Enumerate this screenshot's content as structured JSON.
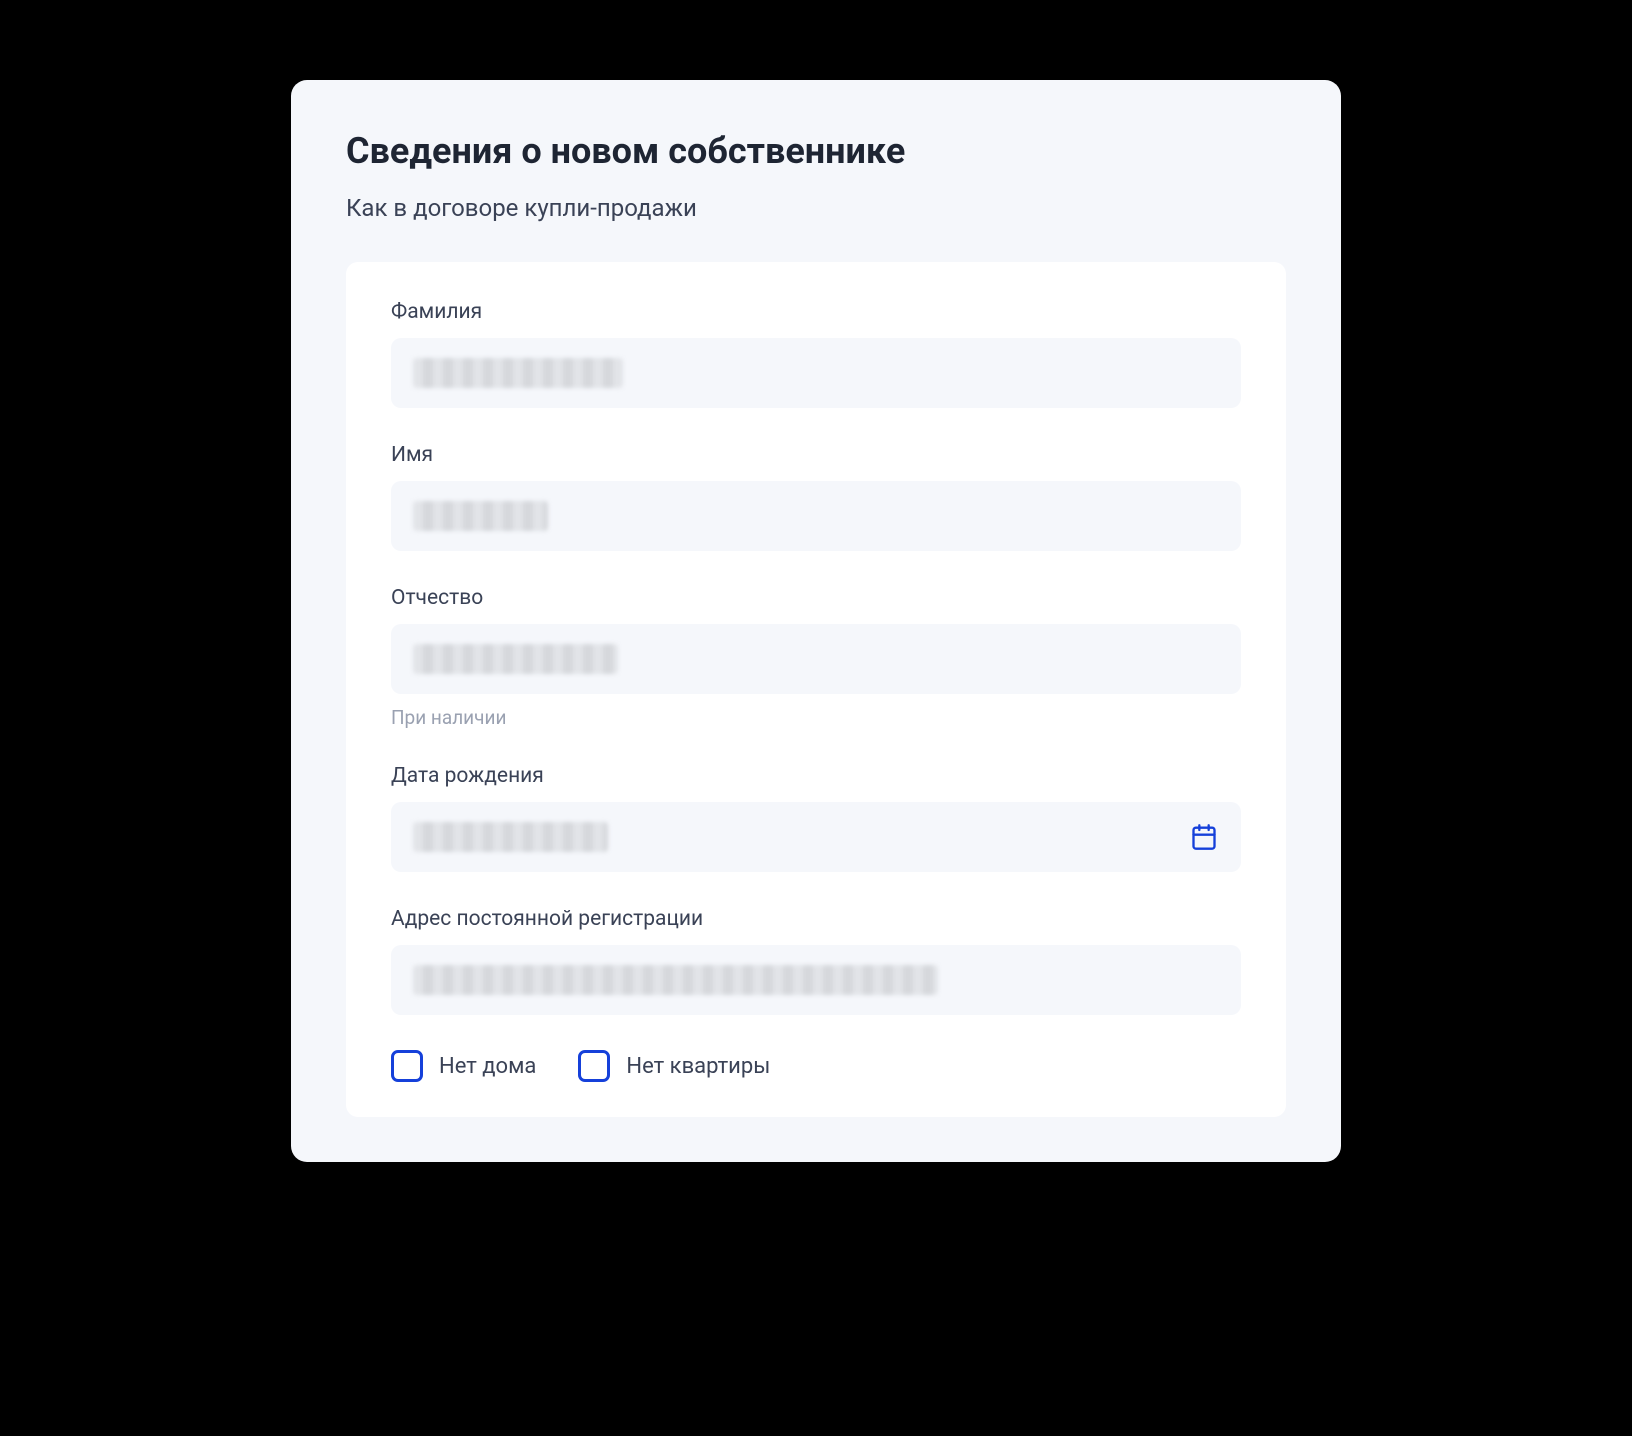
{
  "header": {
    "title": "Сведения о новом собственнике",
    "subtitle": "Как в договоре купли-продажи"
  },
  "fields": {
    "surname": {
      "label": "Фамилия",
      "helper": ""
    },
    "firstname": {
      "label": "Имя",
      "helper": ""
    },
    "patronymic": {
      "label": "Отчество",
      "helper": "При наличии"
    },
    "birthdate": {
      "label": "Дата рождения",
      "helper": ""
    },
    "address": {
      "label": "Адрес постоянной регистрации",
      "helper": ""
    }
  },
  "checkboxes": {
    "no_house": {
      "label": "Нет дома",
      "checked": false
    },
    "no_apartment": {
      "label": "Нет квартиры",
      "checked": false
    }
  },
  "colors": {
    "accent": "#1540da",
    "text_primary": "#1e2533",
    "text_secondary": "#3a4256",
    "text_muted": "#9aa1b1",
    "input_bg": "#f5f7fb",
    "card_bg": "#f5f7fb",
    "panel_bg": "#ffffff"
  }
}
